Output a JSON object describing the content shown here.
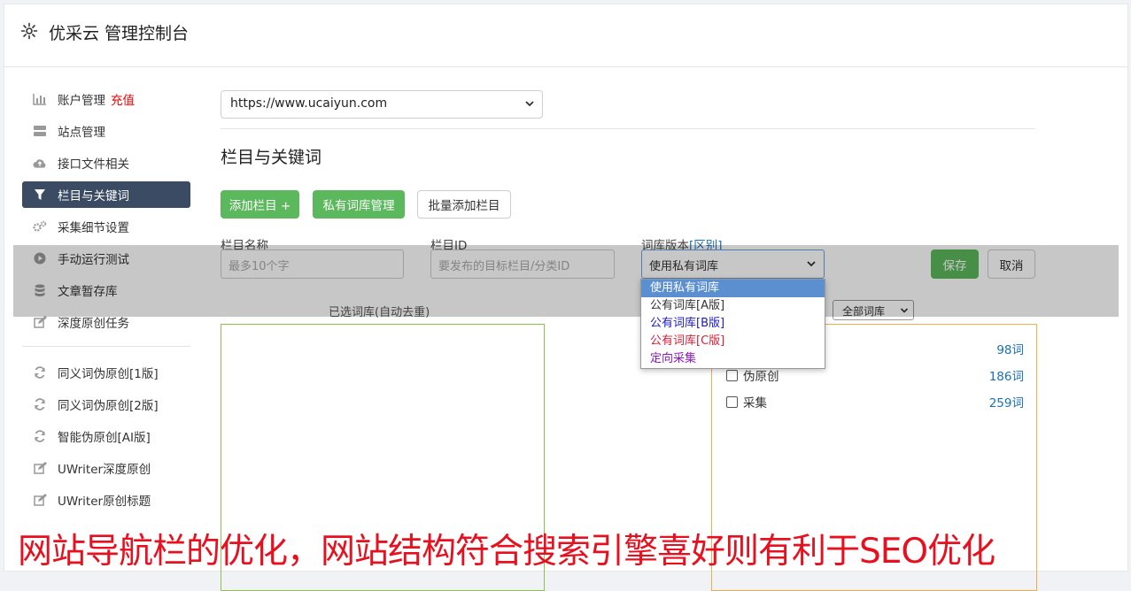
{
  "header": {
    "title": "优采云 管理控制台",
    "icon": "gear-icon"
  },
  "sidebar": {
    "items": [
      {
        "label": "账户管理",
        "extra": "充值",
        "icon": "bar-chart-icon"
      },
      {
        "label": "站点管理",
        "icon": "server-icon"
      },
      {
        "label": "接口文件相关",
        "icon": "cloud-upload-icon"
      },
      {
        "label": "栏目与关键词",
        "icon": "filter-icon",
        "active": true
      },
      {
        "label": "采集细节设置",
        "icon": "cogs-icon"
      },
      {
        "label": "手动运行测试",
        "icon": "play-icon"
      },
      {
        "label": "文章暂存库",
        "icon": "database-icon"
      },
      {
        "label": "深度原创任务",
        "icon": "edit-icon"
      }
    ],
    "items2": [
      {
        "label": "同义词伪原创[1版]",
        "icon": "refresh-icon"
      },
      {
        "label": "同义词伪原创[2版]",
        "icon": "refresh-icon"
      },
      {
        "label": "智能伪原创[AI版]",
        "icon": "refresh-icon"
      },
      {
        "label": "UWriter深度原创",
        "icon": "edit-icon"
      },
      {
        "label": "UWriter原创标题",
        "icon": "edit-icon"
      }
    ]
  },
  "main": {
    "site_select": "https://www.ucaiyun.com",
    "section_title": "栏目与关键词",
    "buttons": {
      "add_column": "添加栏目 +",
      "private_lib": "私有词库管理",
      "batch_add": "批量添加栏目",
      "save": "保存",
      "cancel": "取消"
    },
    "form": {
      "name_label": "栏目名称",
      "name_placeholder": "最多10个字",
      "id_label": "栏目ID",
      "id_placeholder": "要发布的目标栏目/分类ID",
      "version_label": "词库版本",
      "version_link": "[区别]",
      "version_value": "使用私有词库"
    },
    "dropdown_options": [
      "使用私有词库",
      "公有词库[A版]",
      "公有词库[B版]",
      "公有词库[C版]",
      "定向采集"
    ],
    "selected_label": "已选词库(自动去重)",
    "all_lib_select": "全部词库",
    "libraries": [
      {
        "name": "",
        "count": "98词"
      },
      {
        "name": "伪原创",
        "count": "186词"
      },
      {
        "name": "采集",
        "count": "259词"
      }
    ]
  },
  "caption": "网站导航栏的优化，网站结构符合搜索引擎喜好则有利于SEO优化",
  "colors": {
    "active_nav": "#3c4b64",
    "green": "#5cb85c",
    "link": "#1a6fb8",
    "caption": "#e8101e"
  }
}
